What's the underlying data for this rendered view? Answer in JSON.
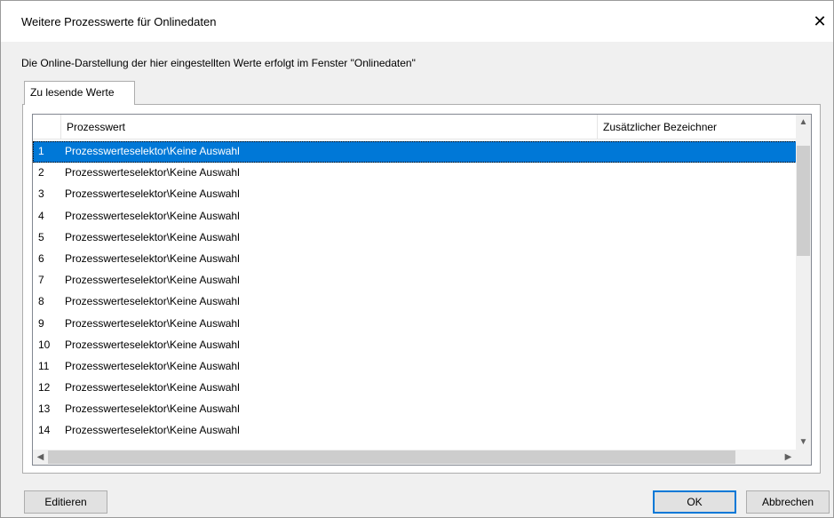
{
  "window": {
    "title": "Weitere Prozesswerte für Onlinedaten",
    "close_icon": "close-icon"
  },
  "description": "Die Online-Darstellung der hier eingestellten Werte erfolgt im Fenster \"Onlinedaten\"",
  "tabs": [
    {
      "label": "Zu lesende Werte",
      "selected": true
    }
  ],
  "table": {
    "columns": [
      "",
      "Prozesswert",
      "Zusätzlicher Bezeichner"
    ],
    "selected_row": 1,
    "rows": [
      {
        "num": "1",
        "value": "Prozesswerteselektor\\Keine Auswahl",
        "extra": ""
      },
      {
        "num": "2",
        "value": "Prozesswerteselektor\\Keine Auswahl",
        "extra": ""
      },
      {
        "num": "3",
        "value": "Prozesswerteselektor\\Keine Auswahl",
        "extra": ""
      },
      {
        "num": "4",
        "value": "Prozesswerteselektor\\Keine Auswahl",
        "extra": ""
      },
      {
        "num": "5",
        "value": "Prozesswerteselektor\\Keine Auswahl",
        "extra": ""
      },
      {
        "num": "6",
        "value": "Prozesswerteselektor\\Keine Auswahl",
        "extra": ""
      },
      {
        "num": "7",
        "value": "Prozesswerteselektor\\Keine Auswahl",
        "extra": ""
      },
      {
        "num": "8",
        "value": "Prozesswerteselektor\\Keine Auswahl",
        "extra": ""
      },
      {
        "num": "9",
        "value": "Prozesswerteselektor\\Keine Auswahl",
        "extra": ""
      },
      {
        "num": "10",
        "value": "Prozesswerteselektor\\Keine Auswahl",
        "extra": ""
      },
      {
        "num": "11",
        "value": "Prozesswerteselektor\\Keine Auswahl",
        "extra": ""
      },
      {
        "num": "12",
        "value": "Prozesswerteselektor\\Keine Auswahl",
        "extra": ""
      },
      {
        "num": "13",
        "value": "Prozesswerteselektor\\Keine Auswahl",
        "extra": ""
      },
      {
        "num": "14",
        "value": "Prozesswerteselektor\\Keine Auswahl",
        "extra": ""
      }
    ]
  },
  "buttons": {
    "edit": "Editieren",
    "ok": "OK",
    "cancel": "Abbrechen"
  },
  "colors": {
    "selection": "#0078d7",
    "default_button_border": "#0078d7"
  }
}
